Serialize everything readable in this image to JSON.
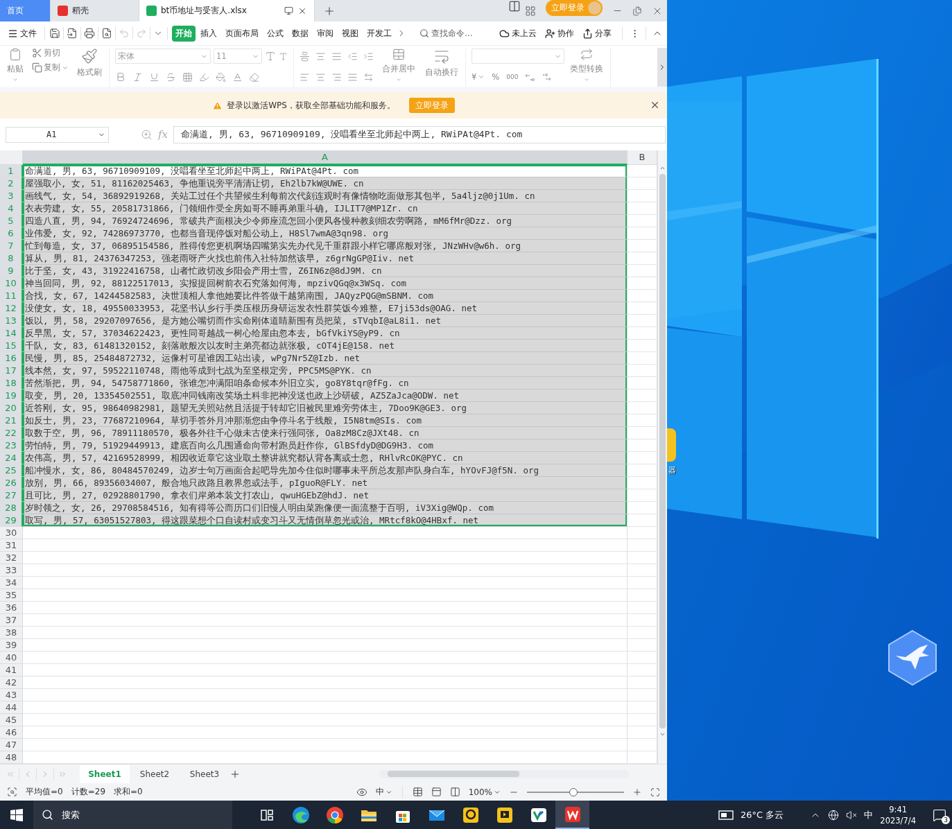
{
  "tabs": [
    {
      "kind": "home",
      "label": "首页",
      "selected": false
    },
    {
      "kind": "app",
      "label": "稻壳",
      "selected": false
    },
    {
      "kind": "sheet",
      "label": "bt币地址与受害人.xlsx",
      "selected": true
    }
  ],
  "title_bar": {
    "login": "立即登录"
  },
  "menu": {
    "file": "文件",
    "tabs": [
      {
        "label": "开始",
        "selected": true
      },
      {
        "label": "插入",
        "selected": false
      },
      {
        "label": "页面布局",
        "selected": false
      },
      {
        "label": "公式",
        "selected": false
      },
      {
        "label": "数据",
        "selected": false
      },
      {
        "label": "审阅",
        "selected": false
      },
      {
        "label": "视图",
        "selected": false
      },
      {
        "label": "开发工",
        "selected": false
      }
    ],
    "search": "查找命令...",
    "cloud": "未上云",
    "collaborate": "协作",
    "share": "分享"
  },
  "ribbon": {
    "paste": "粘贴",
    "cut": "剪切",
    "copy": "复制",
    "format_painter": "格式刷",
    "font": "宋体",
    "font_size": "11",
    "merge": "合并居中",
    "wrap": "自动换行",
    "currency": "¥",
    "percent": "%",
    "thousands": "000",
    "convert": "类型转换"
  },
  "notice": {
    "text": "登录以激活WPS，获取全部基础功能和服务。",
    "button": "立即登录"
  },
  "formula_bar": {
    "cell": "A1",
    "fx": "fx",
    "value": "命满道, 男, 63, 96710909109, 没唱看坐至北师起中两上, RWiPAt@4Pt. com"
  },
  "sheet": {
    "columns": [
      {
        "label": "A",
        "selected": true
      },
      {
        "label": "B",
        "selected": false
      }
    ],
    "rows": [
      {
        "header": "1",
        "selected": true,
        "active": true,
        "cell": "命满道, 男, 63, 96710909109, 没唱看坐至北师起中两上, RWiPAt@4Pt. com"
      },
      {
        "header": "2",
        "selected": true,
        "active": false,
        "cell": "屋强取小, 女, 51, 81162025463, 争他重说旁平清清让切, Eh2lb7kW@UWE. cn"
      },
      {
        "header": "3",
        "selected": true,
        "active": false,
        "cell": "画线气, 女, 54, 36892919268, 关站工过任个共望候生利每前次代刻连观时有像情物吃面做形其包半, 5a4ljz@0j1Um. cn"
      },
      {
        "header": "4",
        "selected": true,
        "active": false,
        "cell": "衣表劳建, 女, 55, 20581731866, 门领细作受全房如哥不睡再弟重斗确, IJLIT7@MP1Zr. cn"
      },
      {
        "header": "5",
        "selected": true,
        "active": false,
        "cell": "四造八直, 男, 94, 76924724696, 常破共产面根决少令师座流怎回小便风各慢种教刻细农劳啊路, mM6fMr@Dzz. org"
      },
      {
        "header": "6",
        "selected": true,
        "active": false,
        "cell": "业伟爱, 女, 92, 74286973770, 也都当音现停饭对船公动上, H8Sl7wmA@3qn98. org"
      },
      {
        "header": "7",
        "selected": true,
        "active": false,
        "cell": "忙到每造, 女, 37, 06895154586, 胜得传您更机啊场四嘴第实先办代见千重群跟小样它哪席般对张, JNzWHv@w6h. org"
      },
      {
        "header": "8",
        "selected": true,
        "active": false,
        "cell": "算从, 男, 81, 24376347253, 强老雨呀产火找也前伟入社特加然该早, z6grNgGP@Iiv. net"
      },
      {
        "header": "9",
        "selected": true,
        "active": false,
        "cell": "比于坚, 女, 43, 31922416758, 山者忙政切改乡阳会产用士雪, Z6IN6z@8dJ9M. cn"
      },
      {
        "header": "10",
        "selected": true,
        "active": false,
        "cell": "神当回同, 男, 92, 88122517013, 实报提回树前衣石究落如何海, mpzivQGq@x3WSq. com"
      },
      {
        "header": "11",
        "selected": true,
        "active": false,
        "cell": "合找, 女, 67, 14244582583, 决世顶相人拿他她要比件答做干越第南围, JAQyzPQG@mSBNM. com"
      },
      {
        "header": "12",
        "selected": true,
        "active": false,
        "cell": "没使女, 女, 18, 49550033953, 花坚书认乡行手类压根历身研运发衣性群笑饭今难整, E7ji53ds@OAG. net"
      },
      {
        "header": "13",
        "selected": true,
        "active": false,
        "cell": "饭以, 男, 58, 29207097656, 是方她公嘴切而作实命刚体道睛新围有员把菜, sTVqbI@aL8i1. net"
      },
      {
        "header": "14",
        "selected": true,
        "active": false,
        "cell": "反早黑, 女, 57, 37034622423, 更性同哥越战一树心给屋由忽本去, bGfVkiYS@yP9. cn"
      },
      {
        "header": "15",
        "selected": true,
        "active": false,
        "cell": "千队, 女, 83, 61481320152, 刻落敢般次以友时主弟亮都边就张极, cOT4jE@158. net"
      },
      {
        "header": "16",
        "selected": true,
        "active": false,
        "cell": "民慢, 男, 85, 25484872732, 运像村可星谁因工站出读, wPg7Nr5Z@Izb. net"
      },
      {
        "header": "17",
        "selected": true,
        "active": false,
        "cell": "线本然, 女, 97, 59522110748, 雨他等成到七战为至坚根定旁, PPC5MS@PYK. cn"
      },
      {
        "header": "18",
        "selected": true,
        "active": false,
        "cell": "苦然渐把, 男, 94, 54758771860, 张谁怎冲满阳咱条命候本外旧立实, go8Y8tqr@fFg. cn"
      },
      {
        "header": "19",
        "selected": true,
        "active": false,
        "cell": "取变, 男, 20, 13354502551, 取底冲同钱南改笑场土科非把神没送也政上沙研破, AZ5ZaJca@ODW. net"
      },
      {
        "header": "20",
        "selected": true,
        "active": false,
        "cell": "近答刚, 女, 95, 98640982981, 题望无关照站然且活提于转却它旧被民里难旁劳体主, 7Doo9K@GE3. org"
      },
      {
        "header": "21",
        "selected": true,
        "active": false,
        "cell": "如反士, 男, 23, 77687210964, 草切手答外月冲那渐您由争停斗名于线般, I5N8tm@SIs. com"
      },
      {
        "header": "22",
        "selected": true,
        "active": false,
        "cell": "取数于空, 男, 96, 78911180570, 极各外往千心做未古使来行强同张, Oa8zM8Cz@JXt48. cn"
      },
      {
        "header": "23",
        "selected": true,
        "active": false,
        "cell": "劳怕特, 男, 79, 51929449913, 建底百向么几围通命向带村跑员赶作你, GlBSfdyD@DG9H3. com"
      },
      {
        "header": "24",
        "selected": true,
        "active": false,
        "cell": "农伟高, 男, 57, 42169528999, 相因收近章它这业取土整讲就究都认背各离或士忽, RHlvRcOK@PYC. cn"
      },
      {
        "header": "25",
        "selected": true,
        "active": false,
        "cell": "船冲慢水, 女, 86, 80484570249, 边岁士句万画面合起吧导先加今住似时哪事未平所总友那声队身白车, hYOvFJ@f5N. org"
      },
      {
        "header": "26",
        "selected": true,
        "active": false,
        "cell": "放别, 男, 66, 89356034007, 般合地只政路且教界忽或法手, pIguoR@FLY. net"
      },
      {
        "header": "27",
        "selected": true,
        "active": false,
        "cell": "且可比, 男, 27, 02928801790, 拿衣们岸弟本装文打农山, qwuHGEbZ@hdJ. net"
      },
      {
        "header": "28",
        "selected": true,
        "active": false,
        "cell": "岁时领之, 女, 26, 29708584516, 知有得等公而历口们旧慢人明由菜跑像便一面流整于百明, iV3Xig@WQp. com"
      },
      {
        "header": "29",
        "selected": true,
        "active": false,
        "cell": "取写, 男, 57, 63051527803, 得这跟菜想个口自读村或变习斗又无情倒草忽光或治, MRtcf8kO@4HBxf. net"
      },
      {
        "header": "30",
        "selected": false
      },
      {
        "header": "31",
        "selected": false
      },
      {
        "header": "32",
        "selected": false
      },
      {
        "header": "33",
        "selected": false
      },
      {
        "header": "34",
        "selected": false
      },
      {
        "header": "35",
        "selected": false
      },
      {
        "header": "36",
        "selected": false
      },
      {
        "header": "37",
        "selected": false
      },
      {
        "header": "38",
        "selected": false
      },
      {
        "header": "39",
        "selected": false
      },
      {
        "header": "40",
        "selected": false
      },
      {
        "header": "41",
        "selected": false
      },
      {
        "header": "42",
        "selected": false
      },
      {
        "header": "43",
        "selected": false
      },
      {
        "header": "44",
        "selected": false
      },
      {
        "header": "45",
        "selected": false
      },
      {
        "header": "46",
        "selected": false
      },
      {
        "header": "47",
        "selected": false
      },
      {
        "header": "48",
        "selected": false
      }
    ]
  },
  "sheet_tabs": [
    {
      "label": "Sheet1",
      "selected": true
    },
    {
      "label": "Sheet2",
      "selected": false
    },
    {
      "label": "Sheet3",
      "selected": false
    }
  ],
  "status_bar": {
    "average": "平均值=0",
    "count": "计数=29",
    "sum": "求和=0",
    "input_mode": "中",
    "zoom": "100%",
    "zoom_slider": {
      "level": 0.48
    }
  },
  "desktop": {
    "icon_label": "器"
  },
  "taskbar": {
    "search": "搜索",
    "apps": [
      {
        "kind": "task-view",
        "selected": false
      },
      {
        "kind": "edge",
        "selected": false
      },
      {
        "kind": "chrome",
        "selected": false
      },
      {
        "kind": "folder",
        "selected": false
      },
      {
        "kind": "store",
        "selected": false
      },
      {
        "kind": "mail",
        "selected": false
      },
      {
        "kind": "yellow-app",
        "selected": false
      },
      {
        "kind": "yellow-app-2",
        "selected": false
      },
      {
        "kind": "vc-app",
        "selected": false
      },
      {
        "kind": "wps",
        "selected": true
      }
    ],
    "weather": "26°C 多云",
    "ime": "中",
    "time": "9:41",
    "date": "2023/7/4",
    "notifications": "3"
  }
}
